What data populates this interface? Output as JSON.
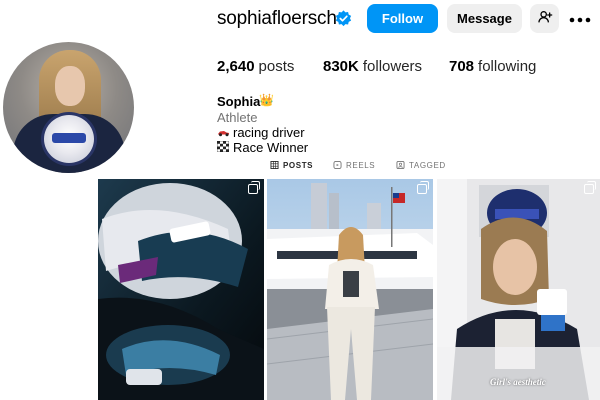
{
  "profile": {
    "username": "sophiafloersch",
    "verified": true,
    "follow_label": "Follow",
    "message_label": "Message",
    "stats": {
      "posts_count": "2,640",
      "posts_label": "posts",
      "followers_count": "830K",
      "followers_label": "followers",
      "following_count": "708",
      "following_label": "following"
    },
    "display_name": "Sophia",
    "name_emoji": "👑",
    "category": "Athlete",
    "bio_lines": [
      {
        "icon": "race-car-icon",
        "text": "racing driver"
      },
      {
        "icon": "checkered-flag-icon",
        "text": "Race Winner"
      }
    ]
  },
  "tabs": [
    {
      "label": "POSTS",
      "icon": "grid-icon",
      "active": true
    },
    {
      "label": "REELS",
      "icon": "reels-icon",
      "active": false
    },
    {
      "label": "TAGGED",
      "icon": "tagged-icon",
      "active": false
    }
  ],
  "posts": [
    {
      "description": "helmet-closeup",
      "multi": true
    },
    {
      "description": "marina-photo",
      "multi": true
    },
    {
      "description": "race-suit-photo",
      "multi": true,
      "overlay_text": "Girl's aesthetic"
    }
  ],
  "colors": {
    "accent": "#0095f6",
    "secondary_button": "#efefef",
    "muted_text": "#737373"
  }
}
